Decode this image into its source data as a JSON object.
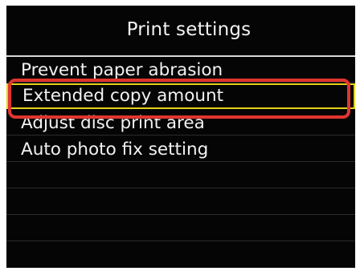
{
  "screen": {
    "title": "Print settings"
  },
  "menu": {
    "items": [
      {
        "label": "Prevent paper abrasion",
        "selected": false
      },
      {
        "label": "Extended copy amount",
        "selected": true
      },
      {
        "label": "Adjust disc print area",
        "selected": false
      },
      {
        "label": "Auto photo fix setting",
        "selected": false
      },
      {
        "label": "",
        "selected": false
      },
      {
        "label": "",
        "selected": false
      },
      {
        "label": "",
        "selected": false
      }
    ]
  },
  "colors": {
    "screen_background": "#050505",
    "text": "#f2f2f2",
    "selection_border": "#e6d21a",
    "annotation_highlight": "#e0352f"
  }
}
